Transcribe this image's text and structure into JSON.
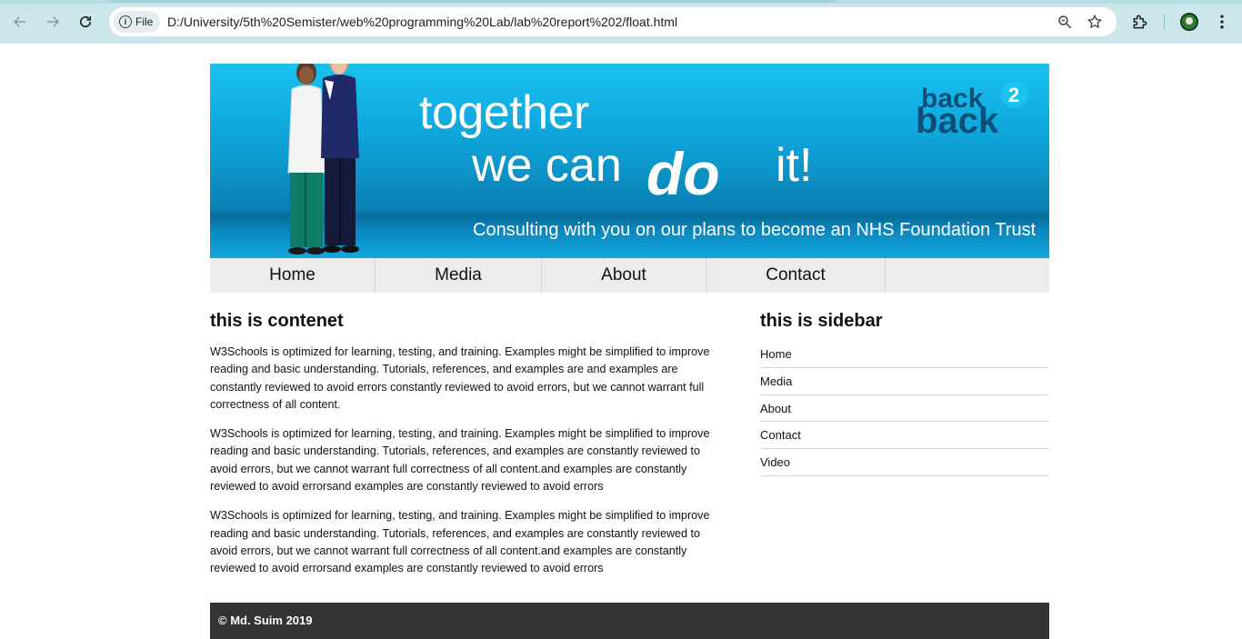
{
  "browser": {
    "url_chip_label": "File",
    "url": "D:/University/5th%20Semister/web%20programming%20Lab/lab%20report%202/float.html",
    "colors": {
      "frame": "#cce7ec",
      "omnibox": "#ffffff"
    }
  },
  "banner": {
    "headline_line1": "together",
    "headline_line2_start": "we can",
    "headline_line2_end": "it!",
    "headline_emphasis": "do",
    "tagline": "Consulting with you on our plans to become an NHS Foundation Trust",
    "logo_text_top": "back",
    "logo_text_bottom": "back",
    "logo_badge": "2",
    "colors": {
      "sky": "#19c2f1",
      "deep": "#066b99",
      "logo": "#0b4f78"
    }
  },
  "nav": {
    "items": [
      {
        "label": "Home"
      },
      {
        "label": "Media"
      },
      {
        "label": "About"
      },
      {
        "label": "Contact"
      }
    ]
  },
  "content": {
    "heading": "this is contenet",
    "paragraphs": [
      "W3Schools is optimized for learning, testing, and training. Examples might be simplified to improve reading and basic understanding. Tutorials, references, and examples are and examples are constantly reviewed to avoid errors constantly reviewed to avoid errors, but we cannot warrant full correctness of all content.",
      "W3Schools is optimized for learning, testing, and training. Examples might be simplified to improve reading and basic understanding. Tutorials, references, and examples are constantly reviewed to avoid errors, but we cannot warrant full correctness of all content.and examples are constantly reviewed to avoid errorsand examples are constantly reviewed to avoid errors",
      "W3Schools is optimized for learning, testing, and training. Examples might be simplified to improve reading and basic understanding. Tutorials, references, and examples are constantly reviewed to avoid errors, but we cannot warrant full correctness of all content.and examples are constantly reviewed to avoid errorsand examples are constantly reviewed to avoid errors"
    ]
  },
  "sidebar": {
    "heading": "this is sidebar",
    "links": [
      {
        "label": "Home"
      },
      {
        "label": "Media"
      },
      {
        "label": "About"
      },
      {
        "label": "Contact"
      },
      {
        "label": "Video"
      }
    ]
  },
  "footer": {
    "text": "© Md. Suim 2019",
    "color": "#333333"
  }
}
